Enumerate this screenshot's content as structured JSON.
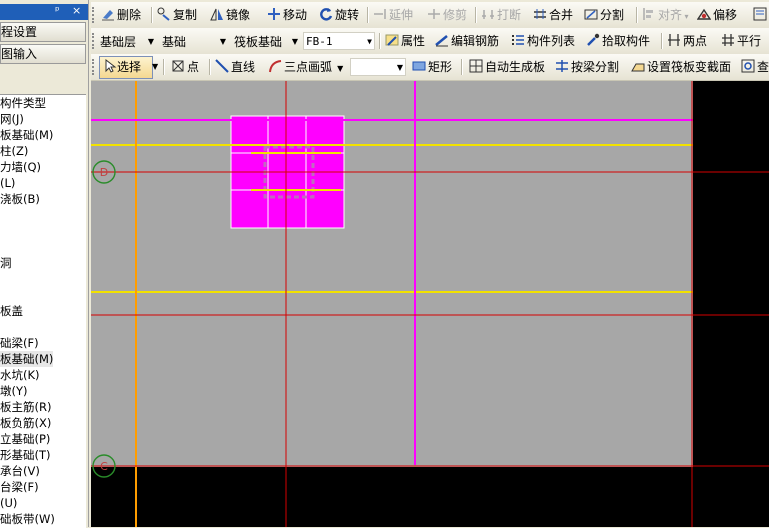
{
  "left_panel": {
    "title": "",
    "pin_label": "ᵖ",
    "close_label": "×",
    "buttons": [
      "程设置",
      "图输入"
    ],
    "tree": [
      "构件类型",
      "网(J)",
      "板基础(M)",
      "柱(Z)",
      "力墙(Q)",
      "(L)",
      "浇板(B)",
      "洞",
      "板盖",
      "础梁(F)",
      "板基础(M)",
      "水坑(K)",
      "墩(Y)",
      "板主筋(R)",
      "板负筋(X)",
      "立基础(P)",
      "形基础(T)",
      "承台(V)",
      "台梁(F)",
      "(U)",
      "础板带(W)"
    ],
    "selected_tree_index": 10
  },
  "toolbar1": {
    "delete": "删除",
    "copy": "复制",
    "mirror": "镜像",
    "move": "移动",
    "rotate": "旋转",
    "extend": "延伸",
    "trim": "修剪",
    "break": "打断",
    "merge": "合并",
    "split": "分割",
    "align": "对齐",
    "offset": "偏移"
  },
  "toolbar2": {
    "floor": "基础层",
    "category": "基础",
    "component_type": "筏板基础",
    "component": "FB-1",
    "properties": "属性",
    "edit_rebar": "编辑钢筋",
    "component_list": "构件列表",
    "pick_component": "拾取构件",
    "two_points": "两点",
    "parallel": "平行"
  },
  "toolbar3": {
    "select": "选择",
    "point": "点",
    "line": "直线",
    "arc": "三点画弧",
    "blank_combo": "",
    "rect": "矩形",
    "auto_generate": "自动生成板",
    "split_by_beam": "按梁分割",
    "set_section": "设置筏板变截面",
    "view": "查"
  },
  "canvas": {
    "axis_labels": [
      "D",
      "C"
    ],
    "colors": {
      "background": "#000000",
      "slab": "#a7a7a7",
      "grid_red": "#d40000",
      "yellow": "#f2e200",
      "magenta": "#ff00ff",
      "orange": "#ff9d00",
      "axis_circle": "#2a8c2a"
    }
  }
}
